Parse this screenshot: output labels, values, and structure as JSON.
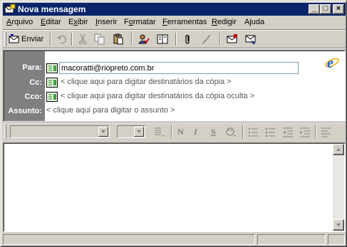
{
  "window": {
    "title": "Nova mensagem",
    "controls": {
      "minimize": "_",
      "maximize": "□",
      "close": "×"
    }
  },
  "menu": [
    {
      "label": "Arquivo",
      "accel": "A"
    },
    {
      "label": "Editar",
      "accel": "E"
    },
    {
      "label": "Exibir",
      "accel": "x"
    },
    {
      "label": "Inserir",
      "accel": "I"
    },
    {
      "label": "Formatar",
      "accel": "o"
    },
    {
      "label": "Ferramentas",
      "accel": "F"
    },
    {
      "label": "Redigir",
      "accel": "R"
    },
    {
      "label": "Ajuda",
      "accel": "j"
    }
  ],
  "toolbar": {
    "send_label": "Enviar",
    "icons": [
      "send-icon",
      "undo-icon",
      "cut-icon",
      "copy-icon",
      "paste-icon",
      "check-names-icon",
      "address-book-icon",
      "attach-icon",
      "signature-icon",
      "encrypt-icon",
      "digital-sign-icon"
    ]
  },
  "header": {
    "to_label": "Para:",
    "to_value": "macoratti@riopreto.com.br",
    "cc_label": "Cc:",
    "cc_hint": "< clique aqui para digitar destinatários da cópia >",
    "bcc_label": "Cco:",
    "bcc_hint": "< clique aqui para digitar destinatários da cópia oculta >",
    "subject_label": "Assunto:",
    "subject_hint": "< clique aqui para digitar o assunto >"
  },
  "format_toolbar": {
    "font_name": "",
    "font_size": "",
    "bold": "N",
    "italic": "I",
    "underline": "S",
    "icons": [
      "paragraph-style-icon",
      "color-icon",
      "numbered-list-icon",
      "bullet-list-icon",
      "decrease-indent-icon",
      "increase-indent-icon",
      "align-left-icon"
    ]
  },
  "body": {
    "text": ""
  },
  "status": {
    "panels": [
      "",
      "",
      ""
    ]
  }
}
